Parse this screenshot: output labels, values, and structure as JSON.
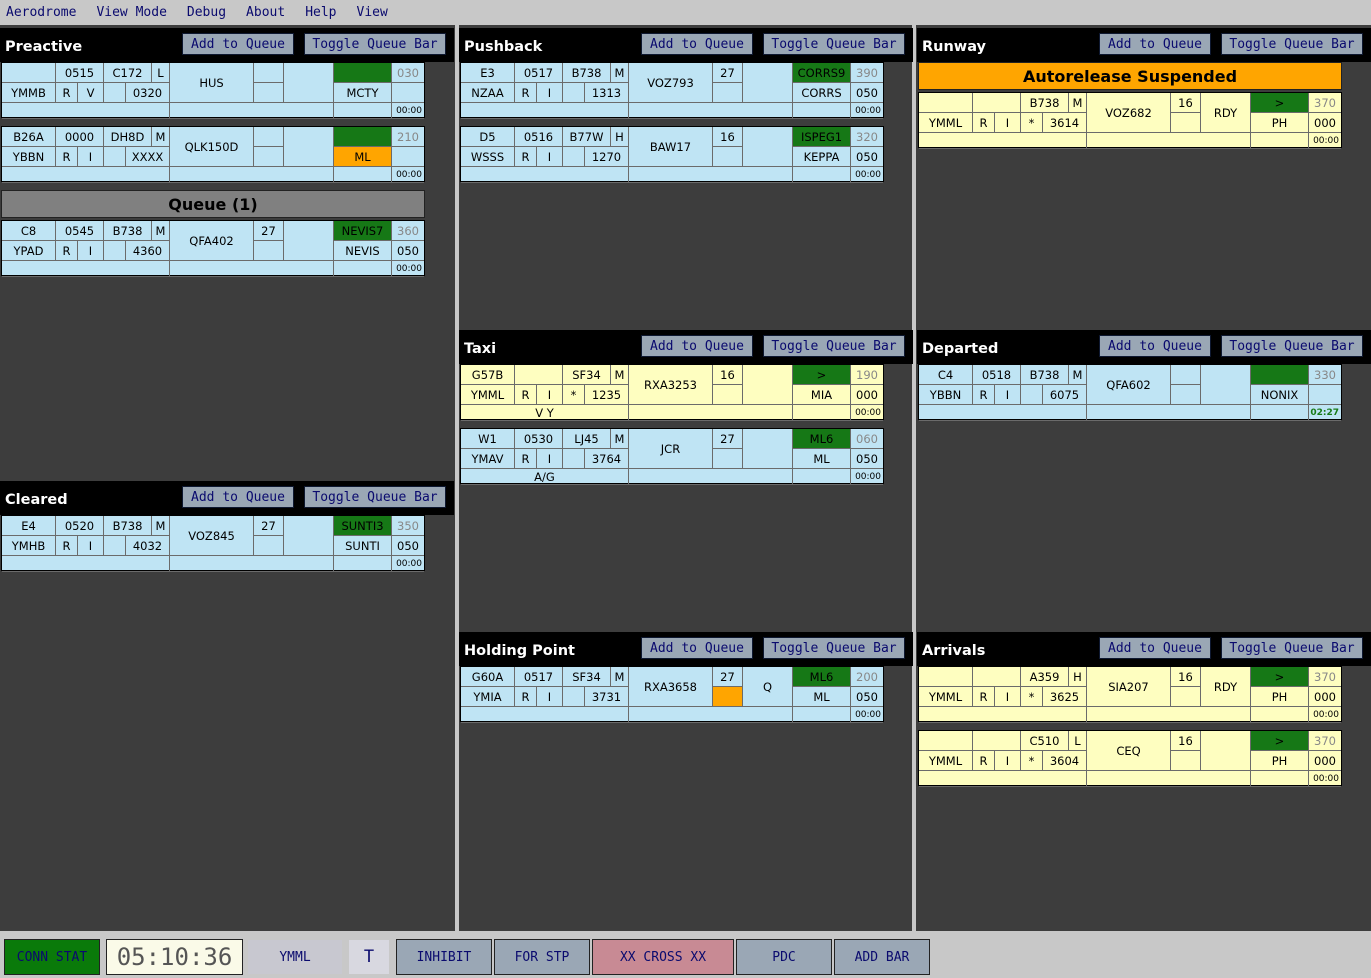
{
  "menu": [
    "Aerodrome",
    "View Mode",
    "Debug",
    "About",
    "Help",
    "View"
  ],
  "buttons": {
    "add": "Add to Queue",
    "toggle": "Toggle Queue Bar"
  },
  "sections": {
    "preactive": {
      "title": "Preactive"
    },
    "pushback": {
      "title": "Pushback"
    },
    "runway": {
      "title": "Runway"
    },
    "cleared": {
      "title": "Cleared"
    },
    "taxi": {
      "title": "Taxi"
    },
    "departed": {
      "title": "Departed"
    },
    "holding": {
      "title": "Holding Point"
    },
    "arrivals": {
      "title": "Arrivals"
    }
  },
  "queue_label": "Queue (1)",
  "autorelease_label": "Autorelease Suspended",
  "strips": [
    {
      "cells": {
        "bay": "",
        "ssr": "0515",
        "type": "C172",
        "wtc": "L",
        "callsign": "HUS",
        "rwy": "",
        "sid": "",
        "cfl": "030",
        "dest": "YMMB",
        "rules": "R",
        "nav": "V",
        "star": "",
        "eobt": "0320",
        "wpt": "MCTY",
        "alt": "",
        "rmk": "",
        "time": "00:00"
      }
    },
    {
      "cells": {
        "bay": "B26A",
        "ssr": "0000",
        "type": "DH8D",
        "wtc": "M",
        "callsign": "QLK150D",
        "rwy": "",
        "sid": "",
        "cfl": "210",
        "dest": "YBBN",
        "rules": "R",
        "nav": "I",
        "star": "",
        "eobt": "XXXX",
        "wpt": "ML",
        "alt": "",
        "rmk": "",
        "time": "00:00"
      }
    },
    {
      "cells": {
        "bay": "C8",
        "ssr": "0545",
        "type": "B738",
        "wtc": "M",
        "callsign": "QFA402",
        "rwy": "27",
        "sid": "NEVIS7",
        "cfl": "360",
        "dest": "YPAD",
        "rules": "R",
        "nav": "I",
        "star": "",
        "eobt": "4360",
        "wpt": "NEVIS",
        "alt": "050",
        "rmk": "",
        "time": "00:00"
      }
    },
    {
      "cells": {
        "bay": "E4",
        "ssr": "0520",
        "type": "B738",
        "wtc": "M",
        "callsign": "VOZ845",
        "rwy": "27",
        "sid": "SUNTI3",
        "cfl": "350",
        "dest": "YMHB",
        "rules": "R",
        "nav": "I",
        "star": "",
        "eobt": "4032",
        "wpt": "SUNTI",
        "alt": "050",
        "rmk": "",
        "time": "00:00"
      }
    },
    {
      "cells": {
        "bay": "E3",
        "ssr": "0517",
        "type": "B738",
        "wtc": "M",
        "callsign": "VOZ793",
        "rwy": "27",
        "sid": "CORRS9",
        "cfl": "390",
        "dest": "NZAA",
        "rules": "R",
        "nav": "I",
        "star": "",
        "eobt": "1313",
        "wpt": "CORRS",
        "alt": "050",
        "rmk": "",
        "time": "00:00"
      }
    },
    {
      "cells": {
        "bay": "D5",
        "ssr": "0516",
        "type": "B77W",
        "wtc": "H",
        "callsign": "BAW17",
        "rwy": "16",
        "sid": "ISPEG1",
        "cfl": "320",
        "dest": "WSSS",
        "rules": "R",
        "nav": "I",
        "star": "",
        "eobt": "1270",
        "wpt": "KEPPA",
        "alt": "050",
        "rmk": "",
        "time": "00:00"
      }
    },
    {
      "cells": {
        "bay": "G57B",
        "ssr": "",
        "type": "SF34",
        "wtc": "M",
        "callsign": "RXA3253",
        "rwy": "16",
        "sid": ">",
        "cfl": "190",
        "dest": "YMML",
        "rules": "R",
        "nav": "I",
        "star": "*",
        "eobt": "1235",
        "wpt": "MIA",
        "alt": "000",
        "rmk": "V Y",
        "time": "00:00"
      }
    },
    {
      "cells": {
        "bay": "W1",
        "ssr": "0530",
        "type": "LJ45",
        "wtc": "M",
        "callsign": "JCR",
        "rwy": "27",
        "sid": "ML6",
        "cfl": "060",
        "dest": "YMAV",
        "rules": "R",
        "nav": "I",
        "star": "",
        "eobt": "3764",
        "wpt": "ML",
        "alt": "050",
        "rmk": "A/G",
        "time": "00:00"
      }
    },
    {
      "cells": {
        "bay": "G60A",
        "ssr": "0517",
        "type": "SF34",
        "wtc": "M",
        "callsign": "RXA3658",
        "rwy": "27",
        "sid": "ML6",
        "cfl": "200",
        "dest": "YMIA",
        "rules": "R",
        "nav": "I",
        "star": "",
        "eobt": "3731",
        "wpt": "ML",
        "alt": "050",
        "rmk": "",
        "time": "00:00",
        "extra": "Q"
      }
    },
    {
      "cells": {
        "bay": "",
        "ssr": "",
        "type": "B738",
        "wtc": "M",
        "callsign": "VOZ682",
        "rwy": "16",
        "sid": ">",
        "cfl": "370",
        "dest": "YMML",
        "rules": "R",
        "nav": "I",
        "star": "*",
        "eobt": "3614",
        "wpt": "PH",
        "alt": "000",
        "rmk": "",
        "time": "00:00",
        "extra": "RDY"
      }
    },
    {
      "cells": {
        "bay": "C4",
        "ssr": "0518",
        "type": "B738",
        "wtc": "M",
        "callsign": "QFA602",
        "rwy": "",
        "sid": "",
        "cfl": "330",
        "dest": "YBBN",
        "rules": "R",
        "nav": "I",
        "star": "",
        "eobt": "6075",
        "wpt": "NONIX",
        "alt": "",
        "rmk": "",
        "time": "02:27"
      }
    },
    {
      "cells": {
        "bay": "",
        "ssr": "",
        "type": "A359",
        "wtc": "H",
        "callsign": "SIA207",
        "rwy": "16",
        "sid": ">",
        "cfl": "370",
        "dest": "YMML",
        "rules": "R",
        "nav": "I",
        "star": "*",
        "eobt": "3625",
        "wpt": "PH",
        "alt": "000",
        "rmk": "",
        "time": "00:00",
        "extra": "RDY"
      }
    },
    {
      "cells": {
        "bay": "",
        "ssr": "",
        "type": "C510",
        "wtc": "L",
        "callsign": "CEQ",
        "rwy": "16",
        "sid": ">",
        "cfl": "370",
        "dest": "YMML",
        "rules": "R",
        "nav": "I",
        "star": "*",
        "eobt": "3604",
        "wpt": "PH",
        "alt": "000",
        "rmk": "",
        "time": "00:00"
      }
    }
  ],
  "status": {
    "conn": "CONN STAT",
    "clock": "05:10:36",
    "aerodrome": "YMML",
    "t": "T",
    "inhibit": "INHIBIT",
    "for_stp": "FOR STP",
    "cross": "XX CROSS XX",
    "pdc": "PDC",
    "add_bar": "ADD BAR"
  },
  "colors": {
    "background": "#3d3d3d",
    "strip_blue": "#bfe4f4",
    "strip_yellow": "#fefec0",
    "green": "#167816",
    "orange": "#ffa500",
    "queue_grey": "#808080",
    "button": "#9aa7b5",
    "conn_green": "#0a7a0a",
    "cross_red": "#c88a94"
  }
}
